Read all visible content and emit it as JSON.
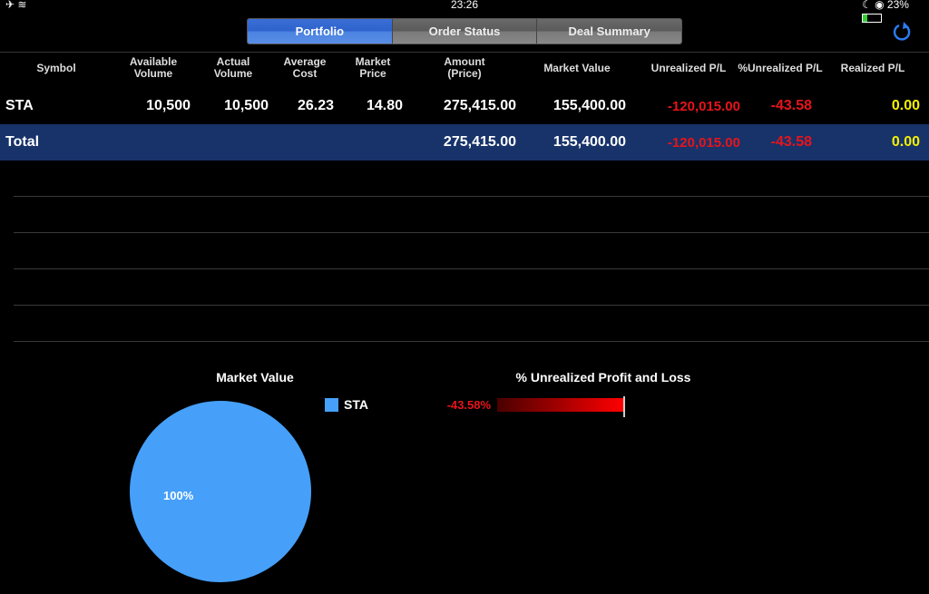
{
  "status_bar": {
    "time": "23:26",
    "battery": "23%"
  },
  "tabs": [
    {
      "label": "Portfolio",
      "active": true
    },
    {
      "label": "Order Status",
      "active": false
    },
    {
      "label": "Deal Summary",
      "active": false
    }
  ],
  "table": {
    "headers": [
      [
        "Symbol",
        ""
      ],
      [
        "Available",
        "Volume"
      ],
      [
        "Actual",
        "Volume"
      ],
      [
        "Average",
        "Cost"
      ],
      [
        "Market",
        "Price"
      ],
      [
        "Amount",
        "(Price)"
      ],
      [
        "Market Value",
        ""
      ],
      [
        "Unrealized P/L",
        ""
      ],
      [
        "%Unrealized P/L",
        ""
      ],
      [
        "Realized P/L",
        ""
      ]
    ],
    "rows": [
      {
        "symbol": "STA",
        "available_volume": "10,500",
        "actual_volume": "10,500",
        "average_cost": "26.23",
        "market_price": "14.80",
        "amount": "275,415.00",
        "market_value": "155,400.00",
        "unrealized_pl": "-120,015.00",
        "pct_unrealized_pl": "-43.58",
        "realized_pl": "0.00"
      }
    ],
    "total": {
      "label": "Total",
      "amount": "275,415.00",
      "market_value": "155,400.00",
      "unrealized_pl": "-120,015.00",
      "pct_unrealized_pl": "-43.58",
      "realized_pl": "0.00"
    }
  },
  "chart_data": [
    {
      "type": "pie",
      "title": "Market Value",
      "slices": [
        {
          "label": "STA",
          "value": 100,
          "display": "100%",
          "color": "#46a0fa"
        }
      ]
    },
    {
      "type": "bar",
      "title": "% Unrealized Profit and Loss",
      "categories": [
        "STA"
      ],
      "values": [
        -43.58
      ],
      "labels": [
        "-43.58%"
      ]
    }
  ]
}
